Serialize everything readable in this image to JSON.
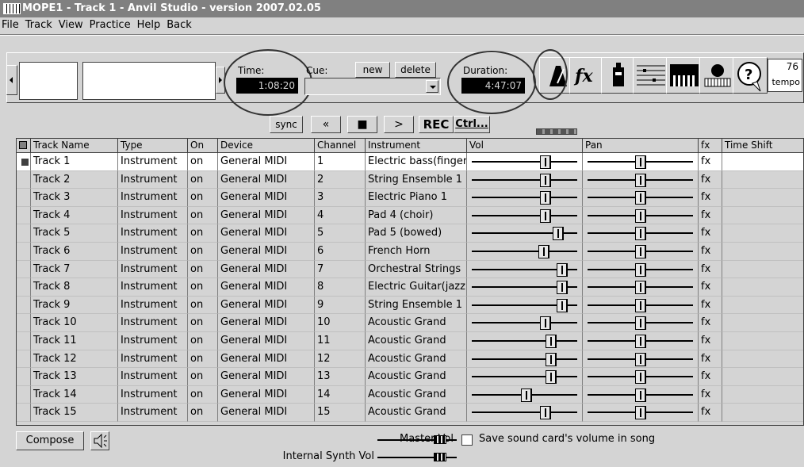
{
  "window": {
    "title": "MOPE1 - Track 1 - Anvil Studio - version 2007.02.05"
  },
  "menu": [
    "File",
    "Track",
    "View",
    "Practice",
    "Help",
    "Back"
  ],
  "toolbar": {
    "time_label": "Time:",
    "time_value": "1:08:20",
    "cue_label": "Cue:",
    "new_label": "new",
    "delete_label": "delete",
    "duration_label": "Duration:",
    "duration_value": "4:47:07",
    "tempo_value": "76",
    "tempo_label": "tempo"
  },
  "transport": {
    "sync": "sync",
    "rewind": "«",
    "stop": "■",
    "play": ">",
    "rec": "REC",
    "ctrl": "Ctrl..."
  },
  "columns": [
    "Track Name",
    "Type",
    "On",
    "Device",
    "Channel",
    "Instrument",
    "Vol",
    "Pan",
    "fx",
    "Time Shift"
  ],
  "tracks": [
    {
      "name": "Track 1",
      "type": "Instrument",
      "on": "on",
      "device": "General MIDI",
      "channel": "1",
      "instrument": "Electric bass(finger)",
      "vol": 0.72,
      "pan": 0.5,
      "fx": "fx",
      "selected": true
    },
    {
      "name": "Track 2",
      "type": "Instrument",
      "on": "on",
      "device": "General MIDI",
      "channel": "2",
      "instrument": "String Ensemble 1",
      "vol": 0.72,
      "pan": 0.5,
      "fx": "fx"
    },
    {
      "name": "Track 3",
      "type": "Instrument",
      "on": "on",
      "device": "General MIDI",
      "channel": "3",
      "instrument": "Electric Piano 1",
      "vol": 0.72,
      "pan": 0.5,
      "fx": "fx"
    },
    {
      "name": "Track 4",
      "type": "Instrument",
      "on": "on",
      "device": "General MIDI",
      "channel": "4",
      "instrument": "Pad 4 (choir)",
      "vol": 0.72,
      "pan": 0.5,
      "fx": "fx"
    },
    {
      "name": "Track 5",
      "type": "Instrument",
      "on": "on",
      "device": "General MIDI",
      "channel": "5",
      "instrument": "Pad 5 (bowed)",
      "vol": 0.86,
      "pan": 0.5,
      "fx": "fx"
    },
    {
      "name": "Track 6",
      "type": "Instrument",
      "on": "on",
      "device": "General MIDI",
      "channel": "6",
      "instrument": "French Horn",
      "vol": 0.71,
      "pan": 0.5,
      "fx": "fx"
    },
    {
      "name": "Track 7",
      "type": "Instrument",
      "on": "on",
      "device": "General MIDI",
      "channel": "7",
      "instrument": "Orchestral Strings",
      "vol": 0.9,
      "pan": 0.5,
      "fx": "fx"
    },
    {
      "name": "Track 8",
      "type": "Instrument",
      "on": "on",
      "device": "General MIDI",
      "channel": "8",
      "instrument": "Electric Guitar(jazz)",
      "vol": 0.9,
      "pan": 0.5,
      "fx": "fx"
    },
    {
      "name": "Track 9",
      "type": "Instrument",
      "on": "on",
      "device": "General MIDI",
      "channel": "9",
      "instrument": "String Ensemble 1",
      "vol": 0.9,
      "pan": 0.5,
      "fx": "fx"
    },
    {
      "name": "Track 10",
      "type": "Instrument",
      "on": "on",
      "device": "General MIDI",
      "channel": "10",
      "instrument": "Acoustic Grand",
      "vol": 0.72,
      "pan": 0.5,
      "fx": "fx"
    },
    {
      "name": "Track 11",
      "type": "Instrument",
      "on": "on",
      "device": "General MIDI",
      "channel": "11",
      "instrument": "Acoustic Grand",
      "vol": 0.78,
      "pan": 0.5,
      "fx": "fx"
    },
    {
      "name": "Track 12",
      "type": "Instrument",
      "on": "on",
      "device": "General MIDI",
      "channel": "12",
      "instrument": "Acoustic Grand",
      "vol": 0.78,
      "pan": 0.5,
      "fx": "fx"
    },
    {
      "name": "Track 13",
      "type": "Instrument",
      "on": "on",
      "device": "General MIDI",
      "channel": "13",
      "instrument": "Acoustic Grand",
      "vol": 0.78,
      "pan": 0.5,
      "fx": "fx"
    },
    {
      "name": "Track 14",
      "type": "Instrument",
      "on": "on",
      "device": "General MIDI",
      "channel": "14",
      "instrument": "Acoustic Grand",
      "vol": 0.52,
      "pan": 0.5,
      "fx": "fx"
    },
    {
      "name": "Track 15",
      "type": "Instrument",
      "on": "on",
      "device": "General MIDI",
      "channel": "15",
      "instrument": "Acoustic Grand",
      "vol": 0.72,
      "pan": 0.5,
      "fx": "fx"
    }
  ],
  "bottom": {
    "compose_label": "Compose",
    "master_vol_label": "Master Vol",
    "master_vol": 0.85,
    "internal_synth_label": "Internal Synth Vol",
    "internal_synth_vol": 0.85,
    "save_volume_label": "Save sound card's volume in song",
    "save_volume_checked": false
  },
  "icons": [
    "app-icon",
    "metronome-icon",
    "fx-icon",
    "mixer-icon",
    "staff-icon",
    "piano-icon",
    "keyboard-icon",
    "help-icon",
    "speaker-icon"
  ]
}
